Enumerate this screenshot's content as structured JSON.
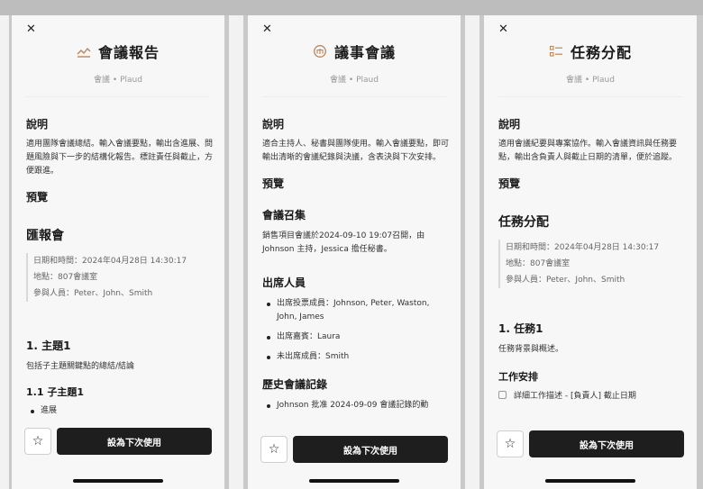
{
  "colors": {
    "accent": "#b9855a",
    "button_bg": "#1e1e1e",
    "panel_bg": "#f7f7f7"
  },
  "common": {
    "close": "✕",
    "meta_label": "會議",
    "meta_sep": "•",
    "meta_brand": "Plaud",
    "desc_heading": "說明",
    "preview_heading": "預覽",
    "use_button": "設為下次使用",
    "star": "☆"
  },
  "panels": [
    {
      "icon": "chart-line-icon",
      "title": "會議報告",
      "desc": "適用團隊會議總結。輸入會議要點，輸出含進展、問題風險與下一步的結構化報告。標註責任與截止，方便跟進。",
      "doc": {
        "h1": "匯報會",
        "info": [
          "日期和時間：2024年04月28日 14:30:17",
          "地點：807會議室",
          "參與人員：Peter、John、Smith"
        ],
        "h2": "1. 主題1",
        "p": "包括子主題關鍵點的總結/結論",
        "h3": "1.1 子主題1",
        "bullets": [
          "進展"
        ]
      }
    },
    {
      "icon": "seal-icon",
      "title": "議事會議",
      "desc": "適合主持人、秘書與團隊使用。輸入會議要點，即可輸出清晰的會議紀錄與決議，含表決與下次安排。",
      "doc": {
        "h1": "會議召集",
        "p": "銷售項目會議於2024-09-10 19:07召開，由 Johnson 主持，Jessica 擔任秘書。",
        "h2": "出席人員",
        "bullets": [
          "出席投票成員：Johnson, Peter, Waston, John, James",
          "出席嘉賓：Laura",
          "未出席成員：Smith"
        ],
        "h2b": "歷史會議記錄",
        "bullets2": [
          "Johnson 批准 2024-09-09 會議記錄的動"
        ]
      }
    },
    {
      "icon": "checklist-icon",
      "title": "任務分配",
      "desc": "適用會議紀要與專案協作。輸入會議資訊與任務要點，輸出含負責人與截止日期的清單，便於追蹤。",
      "doc": {
        "h1": "任務分配",
        "info": [
          "日期和時間：2024年04月28日 14:30:17",
          "地點：807會議室",
          "參與人員：Peter、John、Smith"
        ],
        "h2": "1. 任務1",
        "p": "任務背景與概述。",
        "h3": "工作安排",
        "task": "詳細工作描述 - [負責人] 截止日期"
      }
    }
  ]
}
